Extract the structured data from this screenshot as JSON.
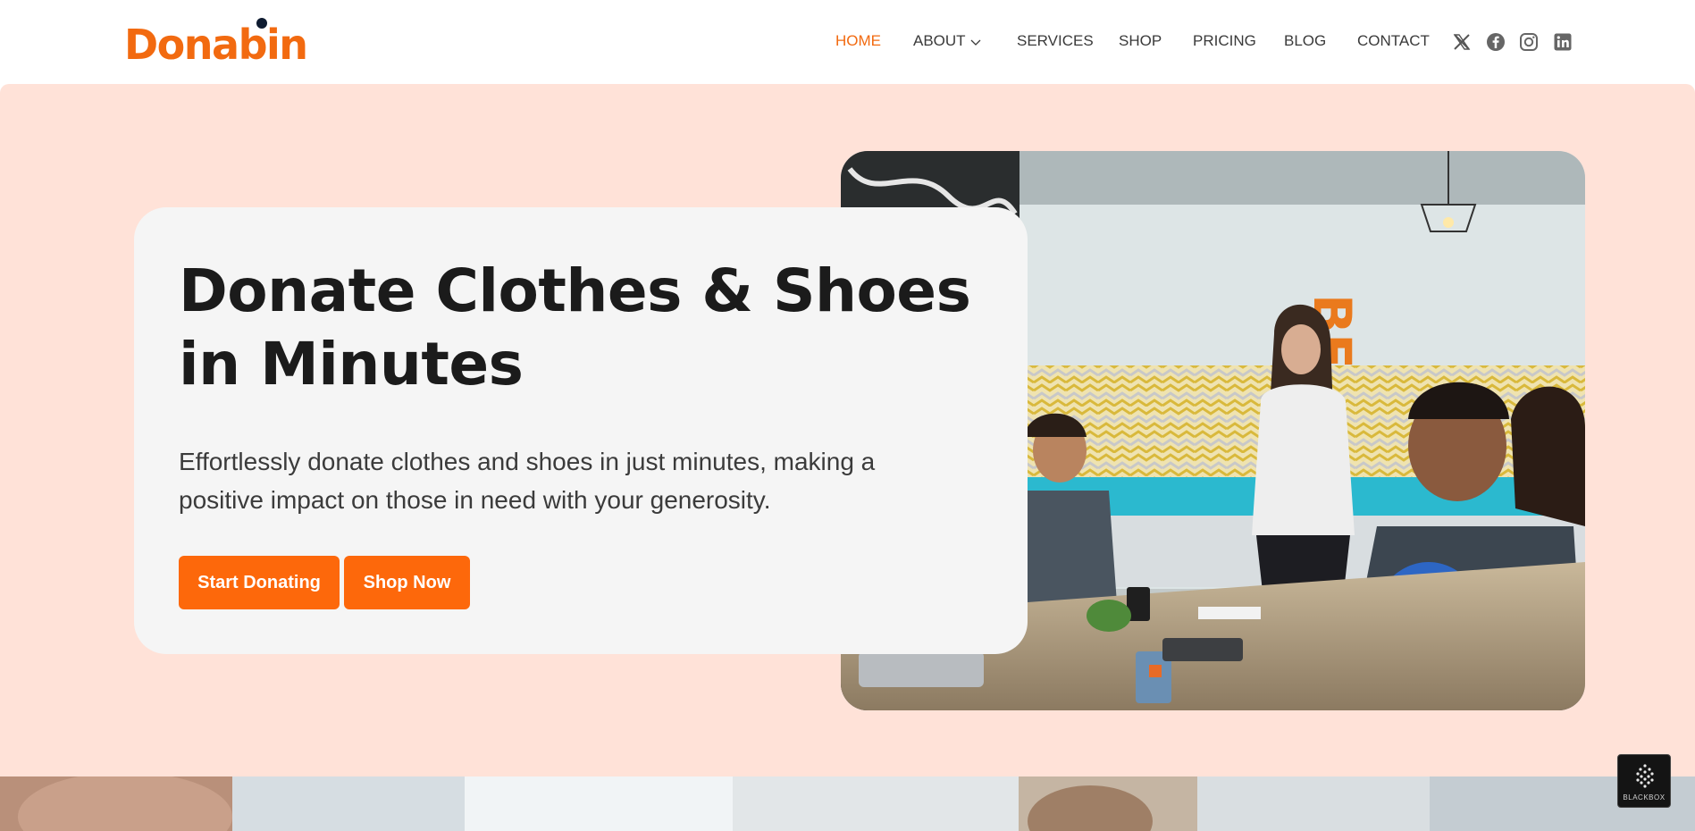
{
  "brand": {
    "name": "Donabin",
    "accent": "#f26a10",
    "dark": "#0e1b30"
  },
  "nav": {
    "items": [
      {
        "label": "HOME",
        "active": true
      },
      {
        "label": "ABOUT",
        "has_dropdown": true
      },
      {
        "label": "SERVICES"
      },
      {
        "label": "SHOP"
      },
      {
        "label": "PRICING"
      },
      {
        "label": "BLOG"
      },
      {
        "label": "CONTACT"
      }
    ],
    "social": [
      "x-icon",
      "facebook-icon",
      "instagram-icon",
      "linkedin-icon"
    ]
  },
  "hero": {
    "title": "Donate Clothes & Shoes in Minutes",
    "subtitle": "Effortlessly donate clothes and shoes in just minutes, making a positive impact on those in need with your generosity.",
    "buttons": {
      "start": "Start Donating",
      "shop": "Shop Now"
    },
    "background": "#ffe2d8",
    "button_color": "#fd680b",
    "image": "meeting-presentation-photo"
  },
  "badge": {
    "label": "BLACKBOX",
    "icon": "blackbox-logo-icon"
  }
}
